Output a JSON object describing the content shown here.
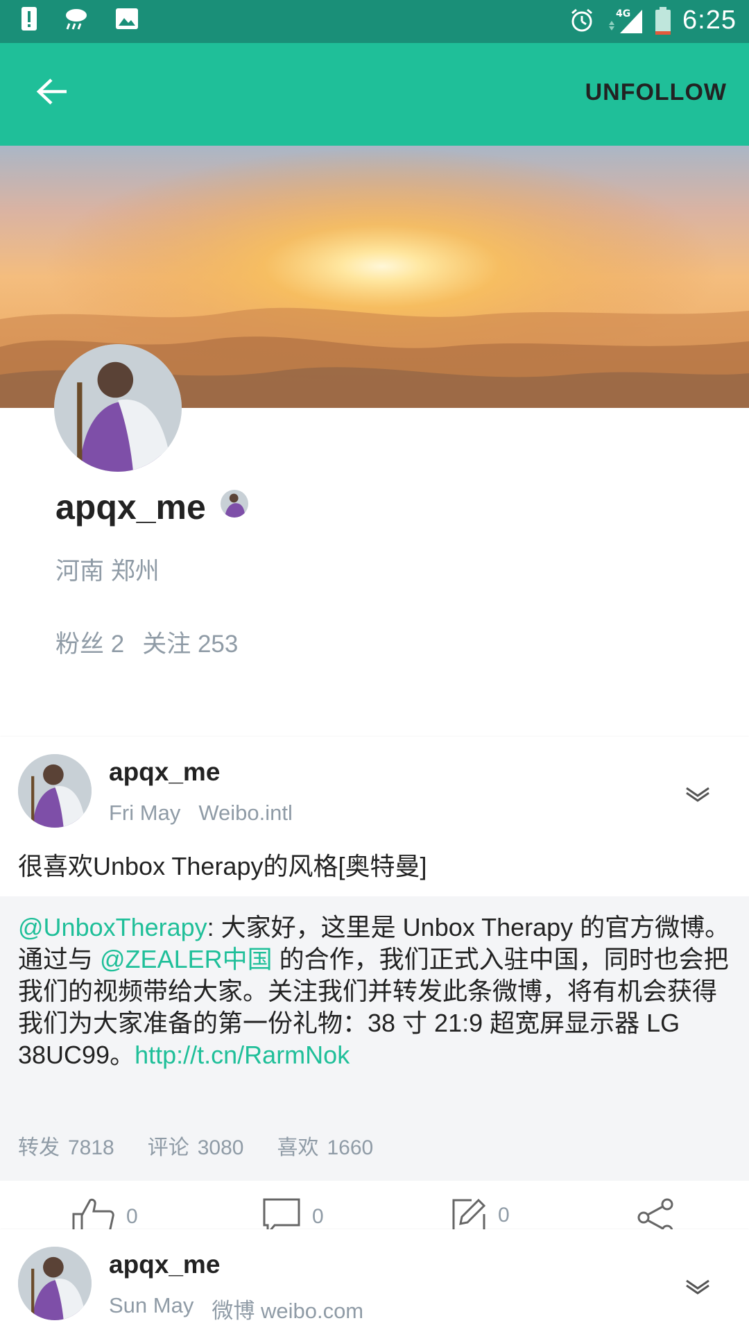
{
  "status_bar": {
    "time": "6:25",
    "network": "4G",
    "icons": [
      "alert-icon",
      "weather-icon",
      "image-icon",
      "alarm-icon",
      "signal-icon",
      "battery-icon"
    ]
  },
  "toolbar": {
    "back_icon": "back-arrow-icon",
    "unfollow_label": "UNFOLLOW",
    "accent": "#1fbf99"
  },
  "profile": {
    "name": "apqx_me",
    "location": "河南 郑州",
    "followers_label": "粉丝",
    "followers": "2",
    "following_label": "关注",
    "following": "253"
  },
  "posts": [
    {
      "author": "apqx_me",
      "date": "Fri May",
      "source": "Weibo.intl",
      "text": "很喜欢Unbox Therapy的风格[奥特曼]",
      "repost": {
        "mention": "@UnboxTherapy",
        "text_1": ": 大家好，这里是 Unbox Therapy 的官方微博。通过与 ",
        "mention_2": "@ZEALER中国",
        "text_2": " 的合作，我们正式入驻中国，同时也会把我们的视频带给大家。关注我们并转发此条微博，将有机会获得我们为大家准备的第一份礼物：38 寸 21:9 超宽屏显示器 LG 38UC99。",
        "link": "http://t.cn/RarmNok",
        "stats": [
          {
            "label": "转发",
            "value": "7818"
          },
          {
            "label": "评论",
            "value": "3080"
          },
          {
            "label": "喜欢",
            "value": "1660"
          }
        ]
      },
      "actions": {
        "like": "0",
        "comment": "0",
        "repost": "0"
      }
    },
    {
      "author": "apqx_me",
      "date": "Sun May",
      "source": "微博 weibo.com"
    }
  ]
}
